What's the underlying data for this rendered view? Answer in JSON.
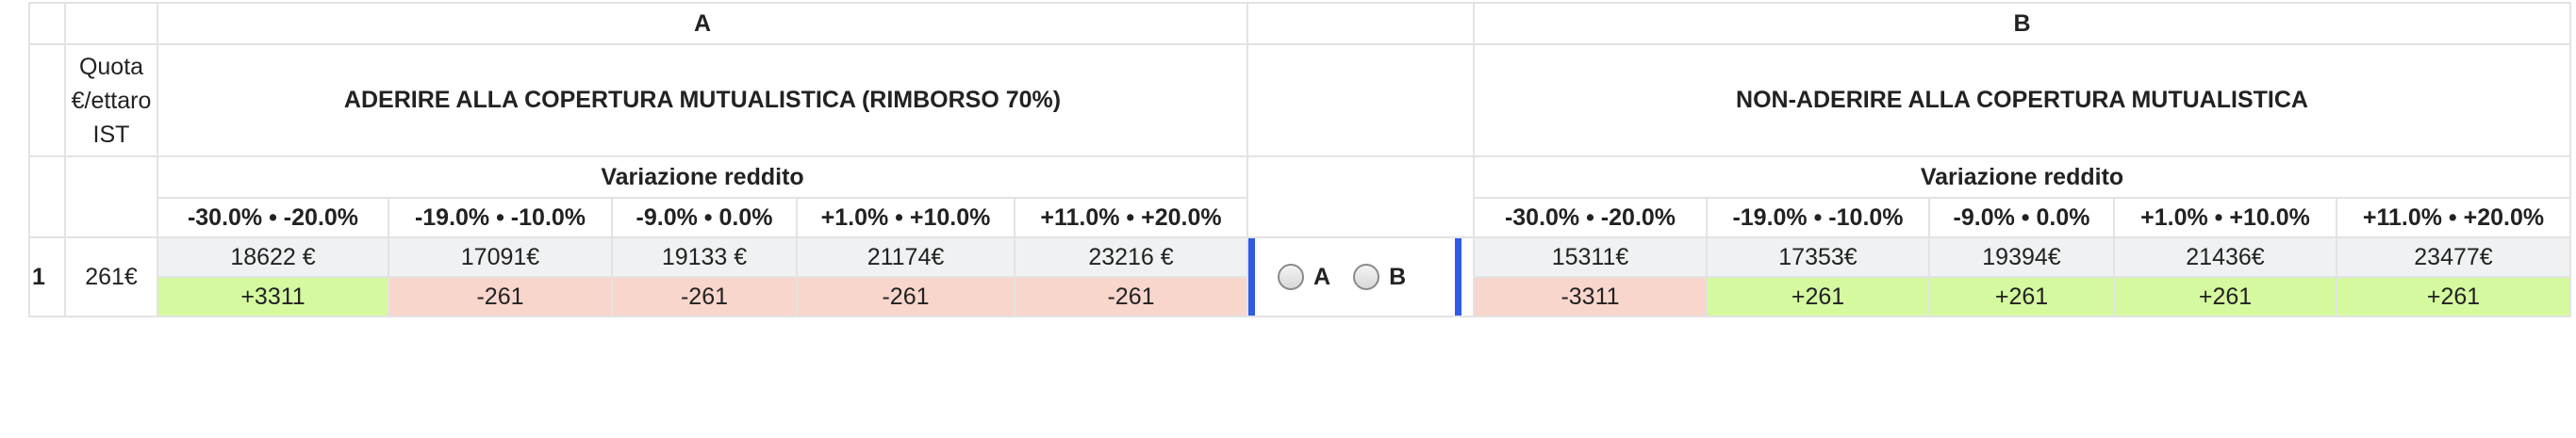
{
  "header": {
    "col_a": "A",
    "col_b": "B"
  },
  "quota_label": [
    "Quota",
    "€/ettaro",
    "IST"
  ],
  "option_a_title": "ADERIRE ALLA COPERTURA MUTUALISTICA (RIMBORSO 70%)",
  "option_b_title": "NON-ADERIRE ALLA COPERTURA MUTUALISTICA",
  "variazione_label": "Variazione reddito",
  "ranges": [
    "-30.0% • -20.0%",
    "-19.0% • -10.0%",
    "-9.0% • 0.0%",
    "+1.0% • +10.0%",
    "+11.0% • +20.0%"
  ],
  "row": {
    "number": "1",
    "quota": "261€",
    "a_values": [
      "18622 €",
      "17091€",
      "19133 €",
      "21174€",
      "23216 €"
    ],
    "a_diffs": [
      "+3311",
      "-261",
      "-261",
      "-261",
      "-261"
    ],
    "b_values": [
      "15311€",
      "17353€",
      "19394€",
      "21436€",
      "23477€"
    ],
    "b_diffs": [
      "-3311",
      "+261",
      "+261",
      "+261",
      "+261"
    ]
  },
  "choice": {
    "option_a": "A",
    "option_b": "B",
    "selected": null
  },
  "colors": {
    "positive": "#d4f99f",
    "negative": "#f8d6cc",
    "highlight_border": "#2e5be8"
  }
}
